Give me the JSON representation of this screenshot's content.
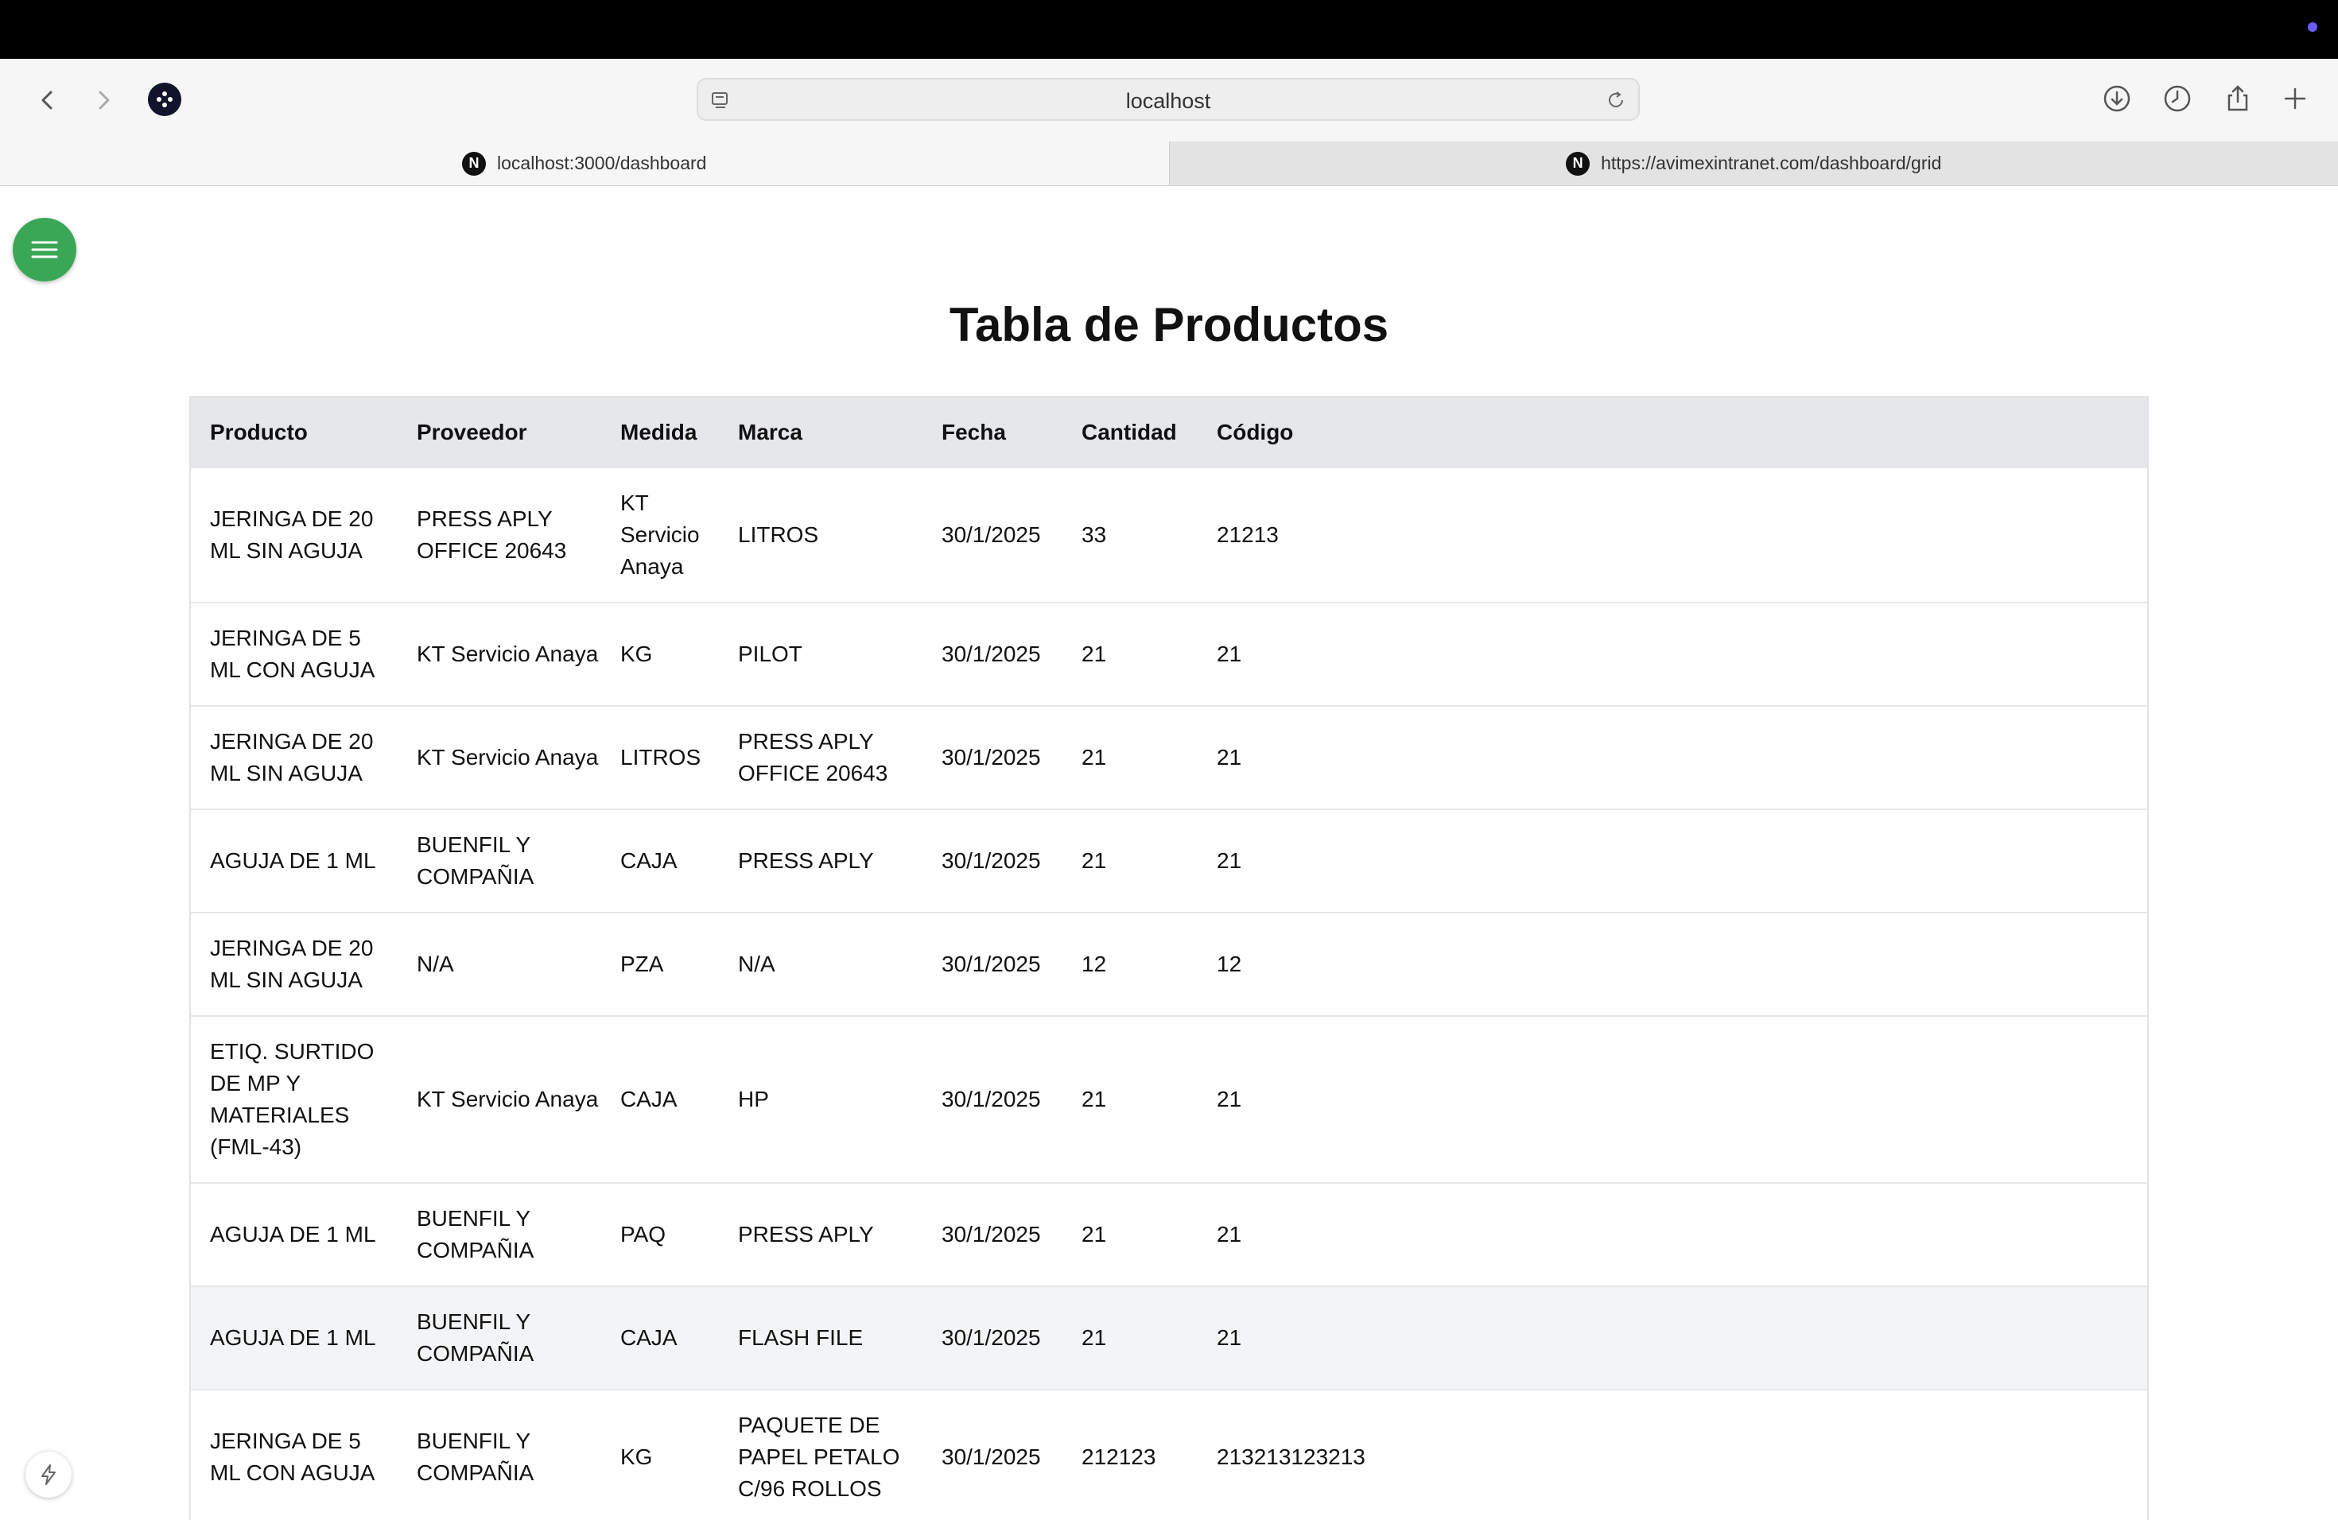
{
  "browser": {
    "address": "localhost",
    "tabs": [
      {
        "label": "localhost:3000/dashboard",
        "favicon": "N"
      },
      {
        "label": "https://avimexintranet.com/dashboard/grid",
        "favicon": "N"
      }
    ]
  },
  "page": {
    "title": "Tabla de Productos",
    "accent_color": "#3aa757"
  },
  "table": {
    "headers": [
      "Producto",
      "Proveedor",
      "Medida",
      "Marca",
      "Fecha",
      "Cantidad",
      "Código"
    ],
    "rows": [
      [
        "JERINGA DE 20 ML SIN AGUJA",
        "PRESS APLY OFFICE 20643",
        "KT Servicio Anaya",
        "LITROS",
        "30/1/2025",
        "33",
        "21213"
      ],
      [
        "JERINGA DE 5 ML CON AGUJA",
        "KT Servicio Anaya",
        "KG",
        "PILOT",
        "30/1/2025",
        "21",
        "21"
      ],
      [
        "JERINGA DE 20 ML SIN AGUJA",
        "KT Servicio Anaya",
        "LITROS",
        "PRESS APLY OFFICE 20643",
        "30/1/2025",
        "21",
        "21"
      ],
      [
        "AGUJA DE 1 ML",
        "BUENFIL Y COMPAÑIA",
        "CAJA",
        "PRESS APLY",
        "30/1/2025",
        "21",
        "21"
      ],
      [
        "JERINGA DE 20 ML SIN AGUJA",
        "N/A",
        "PZA",
        "N/A",
        "30/1/2025",
        "12",
        "12"
      ],
      [
        "ETIQ. SURTIDO DE MP Y MATERIALES (FML-43)",
        "KT Servicio Anaya",
        "CAJA",
        "HP",
        "30/1/2025",
        "21",
        "21"
      ],
      [
        "AGUJA DE 1 ML",
        "BUENFIL Y COMPAÑIA",
        "PAQ",
        "PRESS APLY",
        "30/1/2025",
        "21",
        "21"
      ],
      [
        "AGUJA DE 1 ML",
        "BUENFIL Y COMPAÑIA",
        "CAJA",
        "FLASH FILE",
        "30/1/2025",
        "21",
        "21"
      ],
      [
        "JERINGA DE 5 ML CON AGUJA",
        "BUENFIL Y COMPAÑIA",
        "KG",
        "PAQUETE DE PAPEL PETALO C/96 ROLLOS",
        "30/1/2025",
        "212123",
        "213213123213"
      ]
    ]
  },
  "icons": {
    "menu": "hamburger-icon",
    "back": "chevron-left-icon",
    "forward": "chevron-right-icon",
    "downloads": "download-icon",
    "history": "clock-icon",
    "share": "share-icon",
    "new_tab": "plus-icon",
    "devtools": "bolt-icon"
  }
}
